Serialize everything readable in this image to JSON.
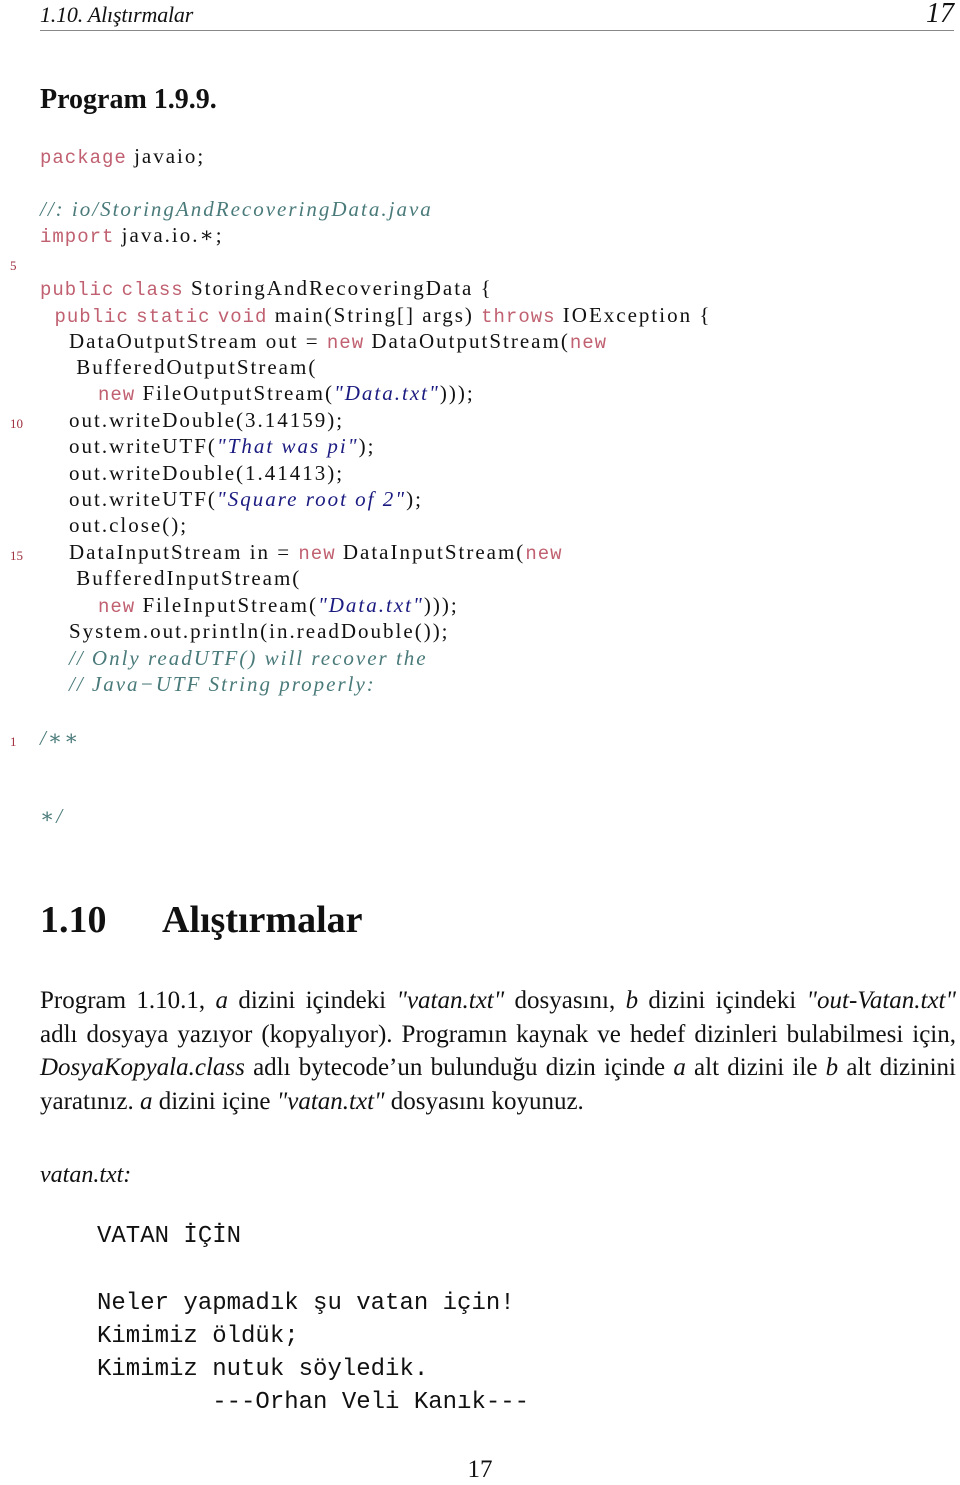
{
  "running_head": {
    "section": "1.10. Alıştırmalar",
    "page_number": "17"
  },
  "program_title": "Program 1.9.9.",
  "colors": {
    "keyword": "#c06070",
    "comment": "#4a7a7a",
    "string": "#1a1a80",
    "line_number": "#a03040"
  },
  "code": {
    "lines": [
      {
        "number": "",
        "segments": [
          {
            "t": "kw",
            "v": "package"
          },
          {
            "t": "pl",
            "v": " javaio;"
          }
        ]
      },
      {
        "number": "",
        "segments": [
          {
            "t": "cm",
            "v": "//: io/StoringAndRecoveringData.java"
          }
        ]
      },
      {
        "number": "",
        "segments": [
          {
            "t": "kw",
            "v": "import"
          },
          {
            "t": "pl",
            "v": " java.io.∗;"
          }
        ]
      },
      {
        "number": "5",
        "segments": []
      },
      {
        "number": "",
        "segments": [
          {
            "t": "kw",
            "v": "public"
          },
          {
            "t": "pl",
            "v": " "
          },
          {
            "t": "kw",
            "v": "class"
          },
          {
            "t": "pl",
            "v": " StoringAndRecoveringData {"
          }
        ]
      },
      {
        "number": "",
        "segments": [
          {
            "t": "pl",
            "v": "  "
          },
          {
            "t": "kw",
            "v": "public"
          },
          {
            "t": "pl",
            "v": " "
          },
          {
            "t": "kw",
            "v": "static"
          },
          {
            "t": "pl",
            "v": " "
          },
          {
            "t": "kw",
            "v": "void"
          },
          {
            "t": "pl",
            "v": " main(String[] args) "
          },
          {
            "t": "kw",
            "v": "throws"
          },
          {
            "t": "pl",
            "v": " IOException {"
          }
        ]
      },
      {
        "number": "",
        "segments": [
          {
            "t": "pl",
            "v": "    DataOutputStream out = "
          },
          {
            "t": "kw",
            "v": "new"
          },
          {
            "t": "pl",
            "v": " DataOutputStream("
          },
          {
            "t": "kw",
            "v": "new"
          }
        ]
      },
      {
        "number": "",
        "segments": [
          {
            "t": "pl",
            "v": "     BufferedOutputStream("
          }
        ]
      },
      {
        "number": "",
        "segments": [
          {
            "t": "pl",
            "v": "        "
          },
          {
            "t": "kw",
            "v": "new"
          },
          {
            "t": "pl",
            "v": " FileOutputStream("
          },
          {
            "t": "st",
            "v": "\"Data.txt\""
          },
          {
            "t": "pl",
            "v": ")));"
          }
        ]
      },
      {
        "number": "10",
        "segments": [
          {
            "t": "pl",
            "v": "    out.writeDouble(3.14159);"
          }
        ]
      },
      {
        "number": "",
        "segments": [
          {
            "t": "pl",
            "v": "    out.writeUTF("
          },
          {
            "t": "st",
            "v": "\"That was pi\""
          },
          {
            "t": "pl",
            "v": ");"
          }
        ]
      },
      {
        "number": "",
        "segments": [
          {
            "t": "pl",
            "v": "    out.writeDouble(1.41413);"
          }
        ]
      },
      {
        "number": "",
        "segments": [
          {
            "t": "pl",
            "v": "    out.writeUTF("
          },
          {
            "t": "st",
            "v": "\"Square root of 2\""
          },
          {
            "t": "pl",
            "v": ");"
          }
        ]
      },
      {
        "number": "",
        "segments": [
          {
            "t": "pl",
            "v": "    out.close();"
          }
        ]
      },
      {
        "number": "15",
        "segments": [
          {
            "t": "pl",
            "v": "    DataInputStream in = "
          },
          {
            "t": "kw",
            "v": "new"
          },
          {
            "t": "pl",
            "v": " DataInputStream("
          },
          {
            "t": "kw",
            "v": "new"
          }
        ]
      },
      {
        "number": "",
        "segments": [
          {
            "t": "pl",
            "v": "     BufferedInputStream("
          }
        ]
      },
      {
        "number": "",
        "segments": [
          {
            "t": "pl",
            "v": "        "
          },
          {
            "t": "kw",
            "v": "new"
          },
          {
            "t": "pl",
            "v": " FileInputStream("
          },
          {
            "t": "st",
            "v": "\"Data.txt\""
          },
          {
            "t": "pl",
            "v": ")));"
          }
        ]
      },
      {
        "number": "",
        "segments": [
          {
            "t": "pl",
            "v": "    System.out.println(in.readDouble());"
          }
        ]
      },
      {
        "number": "",
        "segments": [
          {
            "t": "cm",
            "v": "    // Only readUTF() will recover the"
          }
        ]
      },
      {
        "number": "",
        "segments": [
          {
            "t": "cm",
            "v": "    // Java−UTF String properly:"
          }
        ]
      },
      {
        "number": "1",
        "segments": [
          {
            "t": "cm",
            "v": "/∗∗"
          }
        ]
      },
      {
        "number": "",
        "segments": [
          {
            "t": "cm",
            "v": "∗/"
          }
        ]
      }
    ]
  },
  "section": {
    "number": "1.10",
    "title": "Alıştırmalar"
  },
  "paragraph": {
    "p1": "Program 1.10.1, ",
    "a1": "a",
    "p2": " dizini içindeki ",
    "f1": "\"vatan.txt\"",
    "p3": " dosyasını, ",
    "b1": "b",
    "p4": " dizini içindeki ",
    "f2": "\"out-Vatan.txt\"",
    "p5": " adlı dosyaya yazıyor (kopyalıyor). Programın kaynak ve hedef dizinleri bulabilmesi için, ",
    "f3": "DosyaKopyala.class",
    "p6": " adlı bytecode’un bulunduğu dizin içinde ",
    "a2": "a",
    "p7": " alt dizini ile ",
    "b2": "b",
    "p8": " alt dizinini yaratınız. ",
    "a3": "a",
    "p9": " dizini içine ",
    "f4": "\"vatan.txt\"",
    "p10": " dosyasını koyunuz."
  },
  "file_label": "vatan.txt:",
  "poem": {
    "title": "VATAN İÇİN",
    "lines": [
      "Neler yapmadık şu vatan için!",
      "Kimimiz öldük;",
      "Kimimiz nutuk söyledik."
    ],
    "author": "        ---Orhan Veli Kanık---"
  },
  "footer": {
    "page_number": "17"
  }
}
